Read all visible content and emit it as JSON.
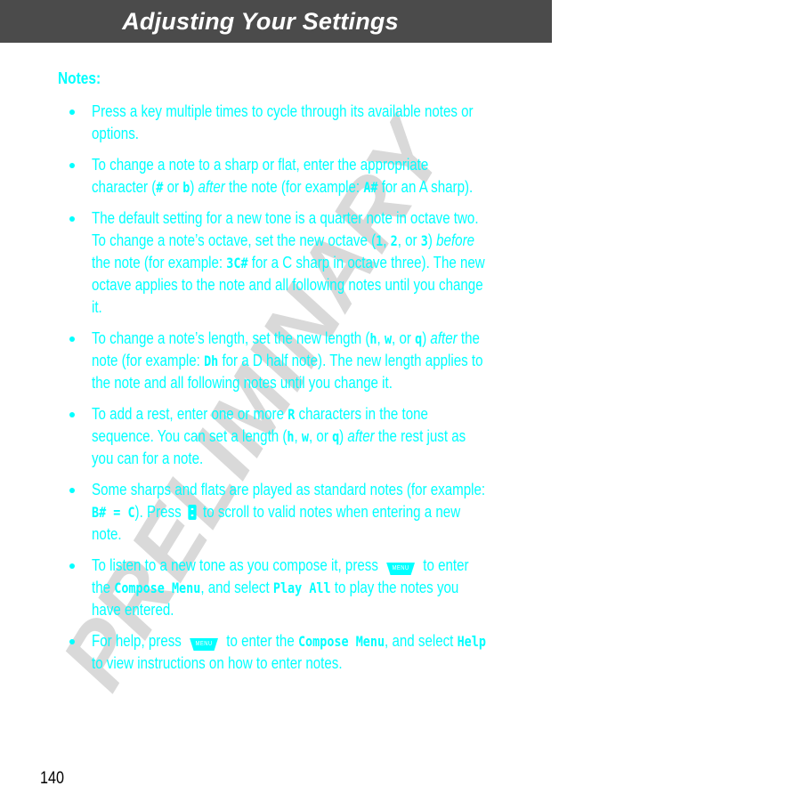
{
  "header": {
    "title": "Adjusting Your Settings"
  },
  "watermark": "PRELIMINARY",
  "section": {
    "heading": "Notes:"
  },
  "notes": [
    {
      "parts": [
        "Press a key multiple times to cycle through its available notes or options."
      ]
    },
    {
      "t1": "To change a note to a sharp or flat, enter the appropriate character (",
      "c1": "#",
      "t2": " or ",
      "c2": "b",
      "t3": ") ",
      "e1": "after",
      "t4": " the note (for example: ",
      "c3": "A#",
      "t5": " for an A sharp)."
    },
    {
      "t1": "The default setting for a new tone is a quarter note in octave two. To change a note’s octave, set the new octave (",
      "c1": "1",
      "t2": ", ",
      "c2": "2",
      "t3": ", or ",
      "c3": "3",
      "t4": ") ",
      "e1": "before",
      "t5": " the note (for example: ",
      "c4": "3C#",
      "t6": " for a C sharp in octave three). The new octave applies to the note and all following notes until you change it."
    },
    {
      "t1": "To change a note’s length, set the new length (",
      "c1": "h",
      "t2": ", ",
      "c2": "w",
      "t3": ", or ",
      "c3": "q",
      "t4": ") ",
      "e1": "after",
      "t5": " the note (for example: ",
      "c4": "Dh",
      "t6": " for a D half note). The new length applies to the note and all following notes until you change it."
    },
    {
      "t1": "To add a rest, enter one or more ",
      "c1": "R",
      "t2": " characters in the tone sequence. You can set a length (",
      "c2": "h",
      "t3": ", ",
      "c3": "w",
      "t4": ", or ",
      "c4": "q",
      "t5": ") ",
      "e1": "after",
      "t6": " the rest just as you can for a note."
    },
    {
      "t1": "Some sharps and flats are played as standard notes (for example: ",
      "c1": "B# = C",
      "t2": "). Press ",
      "icon": "nav-key-icon",
      "t3": " to scroll to valid notes when entering a new note."
    },
    {
      "t1": "To listen to a new tone as you compose it, press ",
      "icon": "menu-key-icon",
      "icon_label": "MENU",
      "t2": " to enter the ",
      "c1": "Compose Menu",
      "t3": ", and select ",
      "c2": "Play All",
      "t4": " to play the notes you have entered."
    },
    {
      "t1": "For help, press ",
      "icon": "menu-key-icon",
      "icon_label": "MENU",
      "t2": " to enter the ",
      "c1": "Compose Menu",
      "t3": ", and select ",
      "c2": "Help",
      "t4": " to view instructions on how to enter notes."
    }
  ],
  "footer": {
    "page_number": "140"
  },
  "colors": {
    "header_bg": "#4b4b4b",
    "text_accent": "#00ffff",
    "watermark": "#d9d9d9"
  }
}
